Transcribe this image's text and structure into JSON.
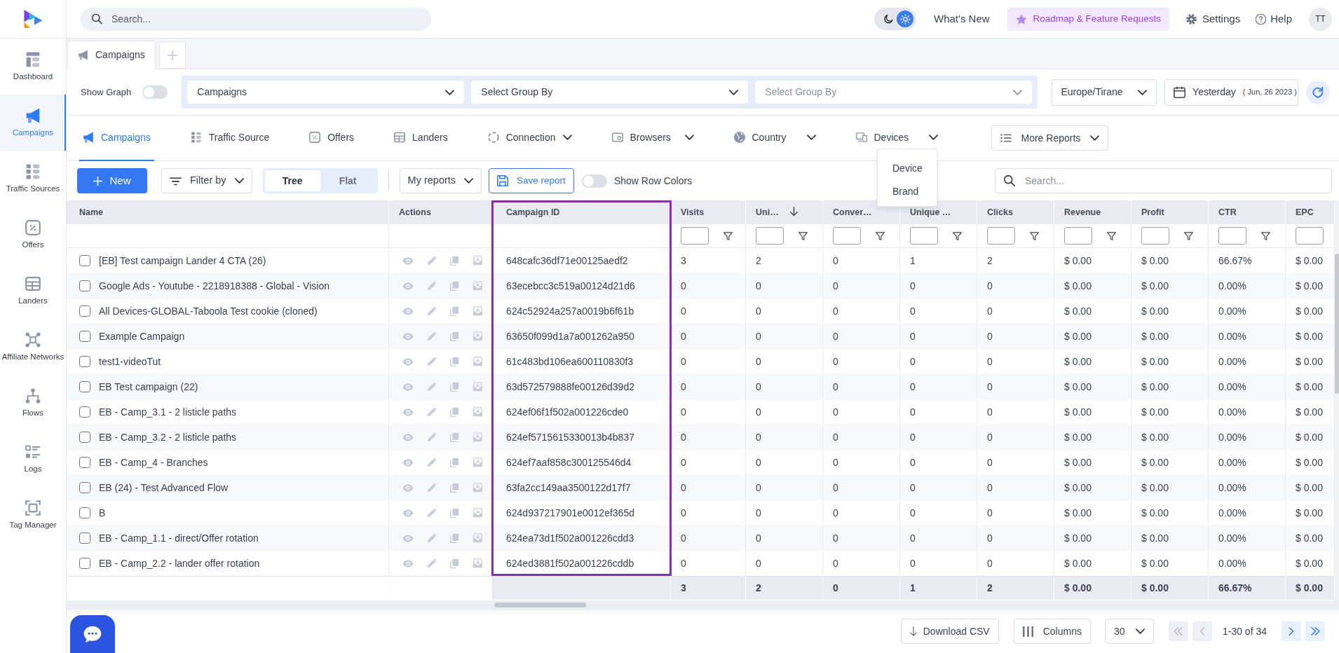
{
  "sidebar": {
    "items": [
      {
        "label": "Dashboard",
        "selected": false
      },
      {
        "label": "Campaigns",
        "selected": true
      },
      {
        "label": "Traffic Sources",
        "selected": false
      },
      {
        "label": "Offers",
        "selected": false
      },
      {
        "label": "Landers",
        "selected": false
      },
      {
        "label": "Affiliate Networks",
        "selected": false
      },
      {
        "label": "Flows",
        "selected": false
      },
      {
        "label": "Logs",
        "selected": false
      },
      {
        "label": "Tag Manager",
        "selected": false
      }
    ]
  },
  "top_bar": {
    "search": {
      "placeholder": "Search..."
    },
    "theme_toggle": [
      {
        "kind": "dark",
        "selected": false
      },
      {
        "kind": "light",
        "selected": true
      }
    ],
    "whats_new": "What's New",
    "roadmap": "Roadmap & Feature Requests",
    "settings": "Settings",
    "help": "Help",
    "avatar": "TT"
  },
  "page_tabs": [
    {
      "label": "Campaigns",
      "selected": true
    }
  ],
  "filters": {
    "show_graph": {
      "label": "Show Graph",
      "on": false
    },
    "group_by": [
      {
        "value": "Campaigns",
        "disabled": false
      },
      {
        "placeholder": "Select Group By",
        "disabled": false
      },
      {
        "placeholder": "Select Group By",
        "disabled": true
      }
    ],
    "timezone": "Europe/Tirane",
    "date": {
      "label": "Yesterday",
      "detail": "( Jun, 26 2023 )"
    }
  },
  "report_tabs": [
    {
      "label": "Campaigns",
      "selected": true,
      "dropdown": false
    },
    {
      "label": "Traffic Source",
      "selected": false,
      "dropdown": false
    },
    {
      "label": "Offers",
      "selected": false,
      "dropdown": false
    },
    {
      "label": "Landers",
      "selected": false,
      "dropdown": false
    },
    {
      "label": "Connection",
      "selected": false,
      "dropdown": true
    },
    {
      "label": "Browsers",
      "selected": false,
      "dropdown": true
    },
    {
      "label": "Country",
      "selected": false,
      "dropdown": true
    },
    {
      "label": "Devices",
      "selected": false,
      "dropdown": true,
      "menu": [
        "Device",
        "Brand"
      ]
    }
  ],
  "more_reports": "More Reports",
  "toolbar": {
    "new_button": "New",
    "filter_by": "Filter by",
    "view_modes": [
      {
        "label": "Tree",
        "selected": true
      },
      {
        "label": "Flat",
        "selected": false
      }
    ],
    "my_reports": "My reports",
    "save_report": "Save report",
    "row_colors": {
      "label": "Show Row Colors",
      "on": false
    },
    "search": {
      "placeholder": "Search..."
    }
  },
  "table": {
    "columns": [
      {
        "label": "Name",
        "highlighted": false,
        "filter": false,
        "sorted": false
      },
      {
        "label": "Actions",
        "highlighted": false,
        "filter": false,
        "sorted": false
      },
      {
        "label": "Campaign ID",
        "highlighted": true,
        "filter": false,
        "sorted": false
      },
      {
        "label": "Visits",
        "highlighted": false,
        "filter": true,
        "sorted": false
      },
      {
        "label": "Uni…",
        "highlighted": false,
        "filter": true,
        "sorted": true
      },
      {
        "label": "Conver…",
        "highlighted": false,
        "filter": true,
        "sorted": false
      },
      {
        "label": "Unique …",
        "highlighted": false,
        "filter": true,
        "sorted": false
      },
      {
        "label": "Clicks",
        "highlighted": false,
        "filter": true,
        "sorted": false
      },
      {
        "label": "Revenue",
        "highlighted": false,
        "filter": true,
        "sorted": false
      },
      {
        "label": "Profit",
        "highlighted": false,
        "filter": true,
        "sorted": false
      },
      {
        "label": "CTR",
        "highlighted": false,
        "filter": true,
        "sorted": false
      },
      {
        "label": "EPC",
        "highlighted": false,
        "filter": true,
        "sorted": false
      }
    ],
    "rows": [
      {
        "checked": false,
        "name": "[EB] Test campaign Lander 4 CTA (26)",
        "campaign_id": "648cafc36df71e00125aedf2",
        "values": [
          "3",
          "2",
          "0",
          "1",
          "2",
          "$ 0.00",
          "$ 0.00",
          "66.67%",
          "$ 0.00"
        ]
      },
      {
        "checked": false,
        "name": "Google Ads - Youtube - 2218918388 - Global - Vision",
        "campaign_id": "63ecebcc3c519a00124d21d6",
        "values": [
          "0",
          "0",
          "0",
          "0",
          "0",
          "$ 0.00",
          "$ 0.00",
          "0.00%",
          "$ 0.00"
        ]
      },
      {
        "checked": false,
        "name": "All Devices-GLOBAL-Taboola Test cookie (cloned)",
        "campaign_id": "624c52924a257a0019b6f61b",
        "values": [
          "0",
          "0",
          "0",
          "0",
          "0",
          "$ 0.00",
          "$ 0.00",
          "0.00%",
          "$ 0.00"
        ]
      },
      {
        "checked": false,
        "name": "Example Campaign",
        "campaign_id": "63650f099d1a7a001262a950",
        "values": [
          "0",
          "0",
          "0",
          "0",
          "0",
          "$ 0.00",
          "$ 0.00",
          "0.00%",
          "$ 0.00"
        ]
      },
      {
        "checked": false,
        "name": "test1-videoTut",
        "campaign_id": "61c483bd106ea600110830f3",
        "values": [
          "0",
          "0",
          "0",
          "0",
          "0",
          "$ 0.00",
          "$ 0.00",
          "0.00%",
          "$ 0.00"
        ]
      },
      {
        "checked": false,
        "name": "EB Test campaign (22)",
        "campaign_id": "63d572579888fe00126d39d2",
        "values": [
          "0",
          "0",
          "0",
          "0",
          "0",
          "$ 0.00",
          "$ 0.00",
          "0.00%",
          "$ 0.00"
        ]
      },
      {
        "checked": false,
        "name": "EB - Camp_3.1 - 2 listicle paths",
        "campaign_id": "624ef06f1f502a001226cde0",
        "values": [
          "0",
          "0",
          "0",
          "0",
          "0",
          "$ 0.00",
          "$ 0.00",
          "0.00%",
          "$ 0.00"
        ]
      },
      {
        "checked": false,
        "name": "EB - Camp_3.2 - 2 listicle paths",
        "campaign_id": "624ef5715615330013b4b837",
        "values": [
          "0",
          "0",
          "0",
          "0",
          "0",
          "$ 0.00",
          "$ 0.00",
          "0.00%",
          "$ 0.00"
        ]
      },
      {
        "checked": false,
        "name": "EB - Camp_4 - Branches",
        "campaign_id": "624ef7aaf858c300125546d4",
        "values": [
          "0",
          "0",
          "0",
          "0",
          "0",
          "$ 0.00",
          "$ 0.00",
          "0.00%",
          "$ 0.00"
        ]
      },
      {
        "checked": false,
        "name": "EB (24) - Test Advanced Flow",
        "campaign_id": "63fa2cc149aa3500122d17f7",
        "values": [
          "0",
          "0",
          "0",
          "0",
          "0",
          "$ 0.00",
          "$ 0.00",
          "0.00%",
          "$ 0.00"
        ]
      },
      {
        "checked": false,
        "name": "B",
        "campaign_id": "624d937217901e0012ef365d",
        "values": [
          "0",
          "0",
          "0",
          "0",
          "0",
          "$ 0.00",
          "$ 0.00",
          "0.00%",
          "$ 0.00"
        ]
      },
      {
        "checked": false,
        "name": "EB - Camp_1.1 - direct/Offer rotation",
        "campaign_id": "624ea73d1f502a001226cdd3",
        "values": [
          "0",
          "0",
          "0",
          "0",
          "0",
          "$ 0.00",
          "$ 0.00",
          "0.00%",
          "$ 0.00"
        ]
      },
      {
        "checked": false,
        "name": "EB - Camp_2.2 - lander offer rotation",
        "campaign_id": "624ed3881f502a001226cddb",
        "values": [
          "0",
          "0",
          "0",
          "0",
          "0",
          "$ 0.00",
          "$ 0.00",
          "0.00%",
          "$ 0.00"
        ]
      }
    ],
    "totals": [
      "3",
      "2",
      "0",
      "1",
      "2",
      "$ 0.00",
      "$ 0.00",
      "66.67%",
      "$ 0.00"
    ]
  },
  "footer": {
    "download": "Download CSV",
    "columns": "Columns",
    "page_size": "30",
    "pager": [
      {
        "kind": "first",
        "disabled": true
      },
      {
        "kind": "prev",
        "disabled": true
      },
      {
        "kind": "next",
        "disabled": false
      },
      {
        "kind": "last",
        "disabled": false
      }
    ],
    "range": "1-30 of 34"
  }
}
